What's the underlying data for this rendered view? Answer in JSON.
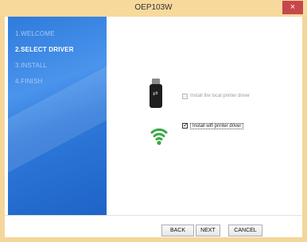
{
  "window": {
    "title": "OEP103W",
    "close_label": "×"
  },
  "steps": [
    {
      "label": "1.WELCOME",
      "state": "done"
    },
    {
      "label": "2.SELECT DRIVER",
      "state": "current"
    },
    {
      "label": "3.INSTALL",
      "state": "pending"
    },
    {
      "label": "4.FINISH",
      "state": "pending"
    }
  ],
  "options": {
    "local": {
      "label": "Install the local printer driver",
      "checked": false,
      "icon": "usb-drive-icon"
    },
    "wifi": {
      "label": "Install wifi printer driver",
      "checked": true,
      "icon": "wifi-icon"
    }
  },
  "buttons": {
    "back": "BACK",
    "next": "NEXT",
    "cancel": "CANCEL"
  },
  "colors": {
    "title_bar": "#f7d99c",
    "close": "#c7474c",
    "sidebar": "#2f7bdb",
    "wifi": "#3aa845"
  }
}
